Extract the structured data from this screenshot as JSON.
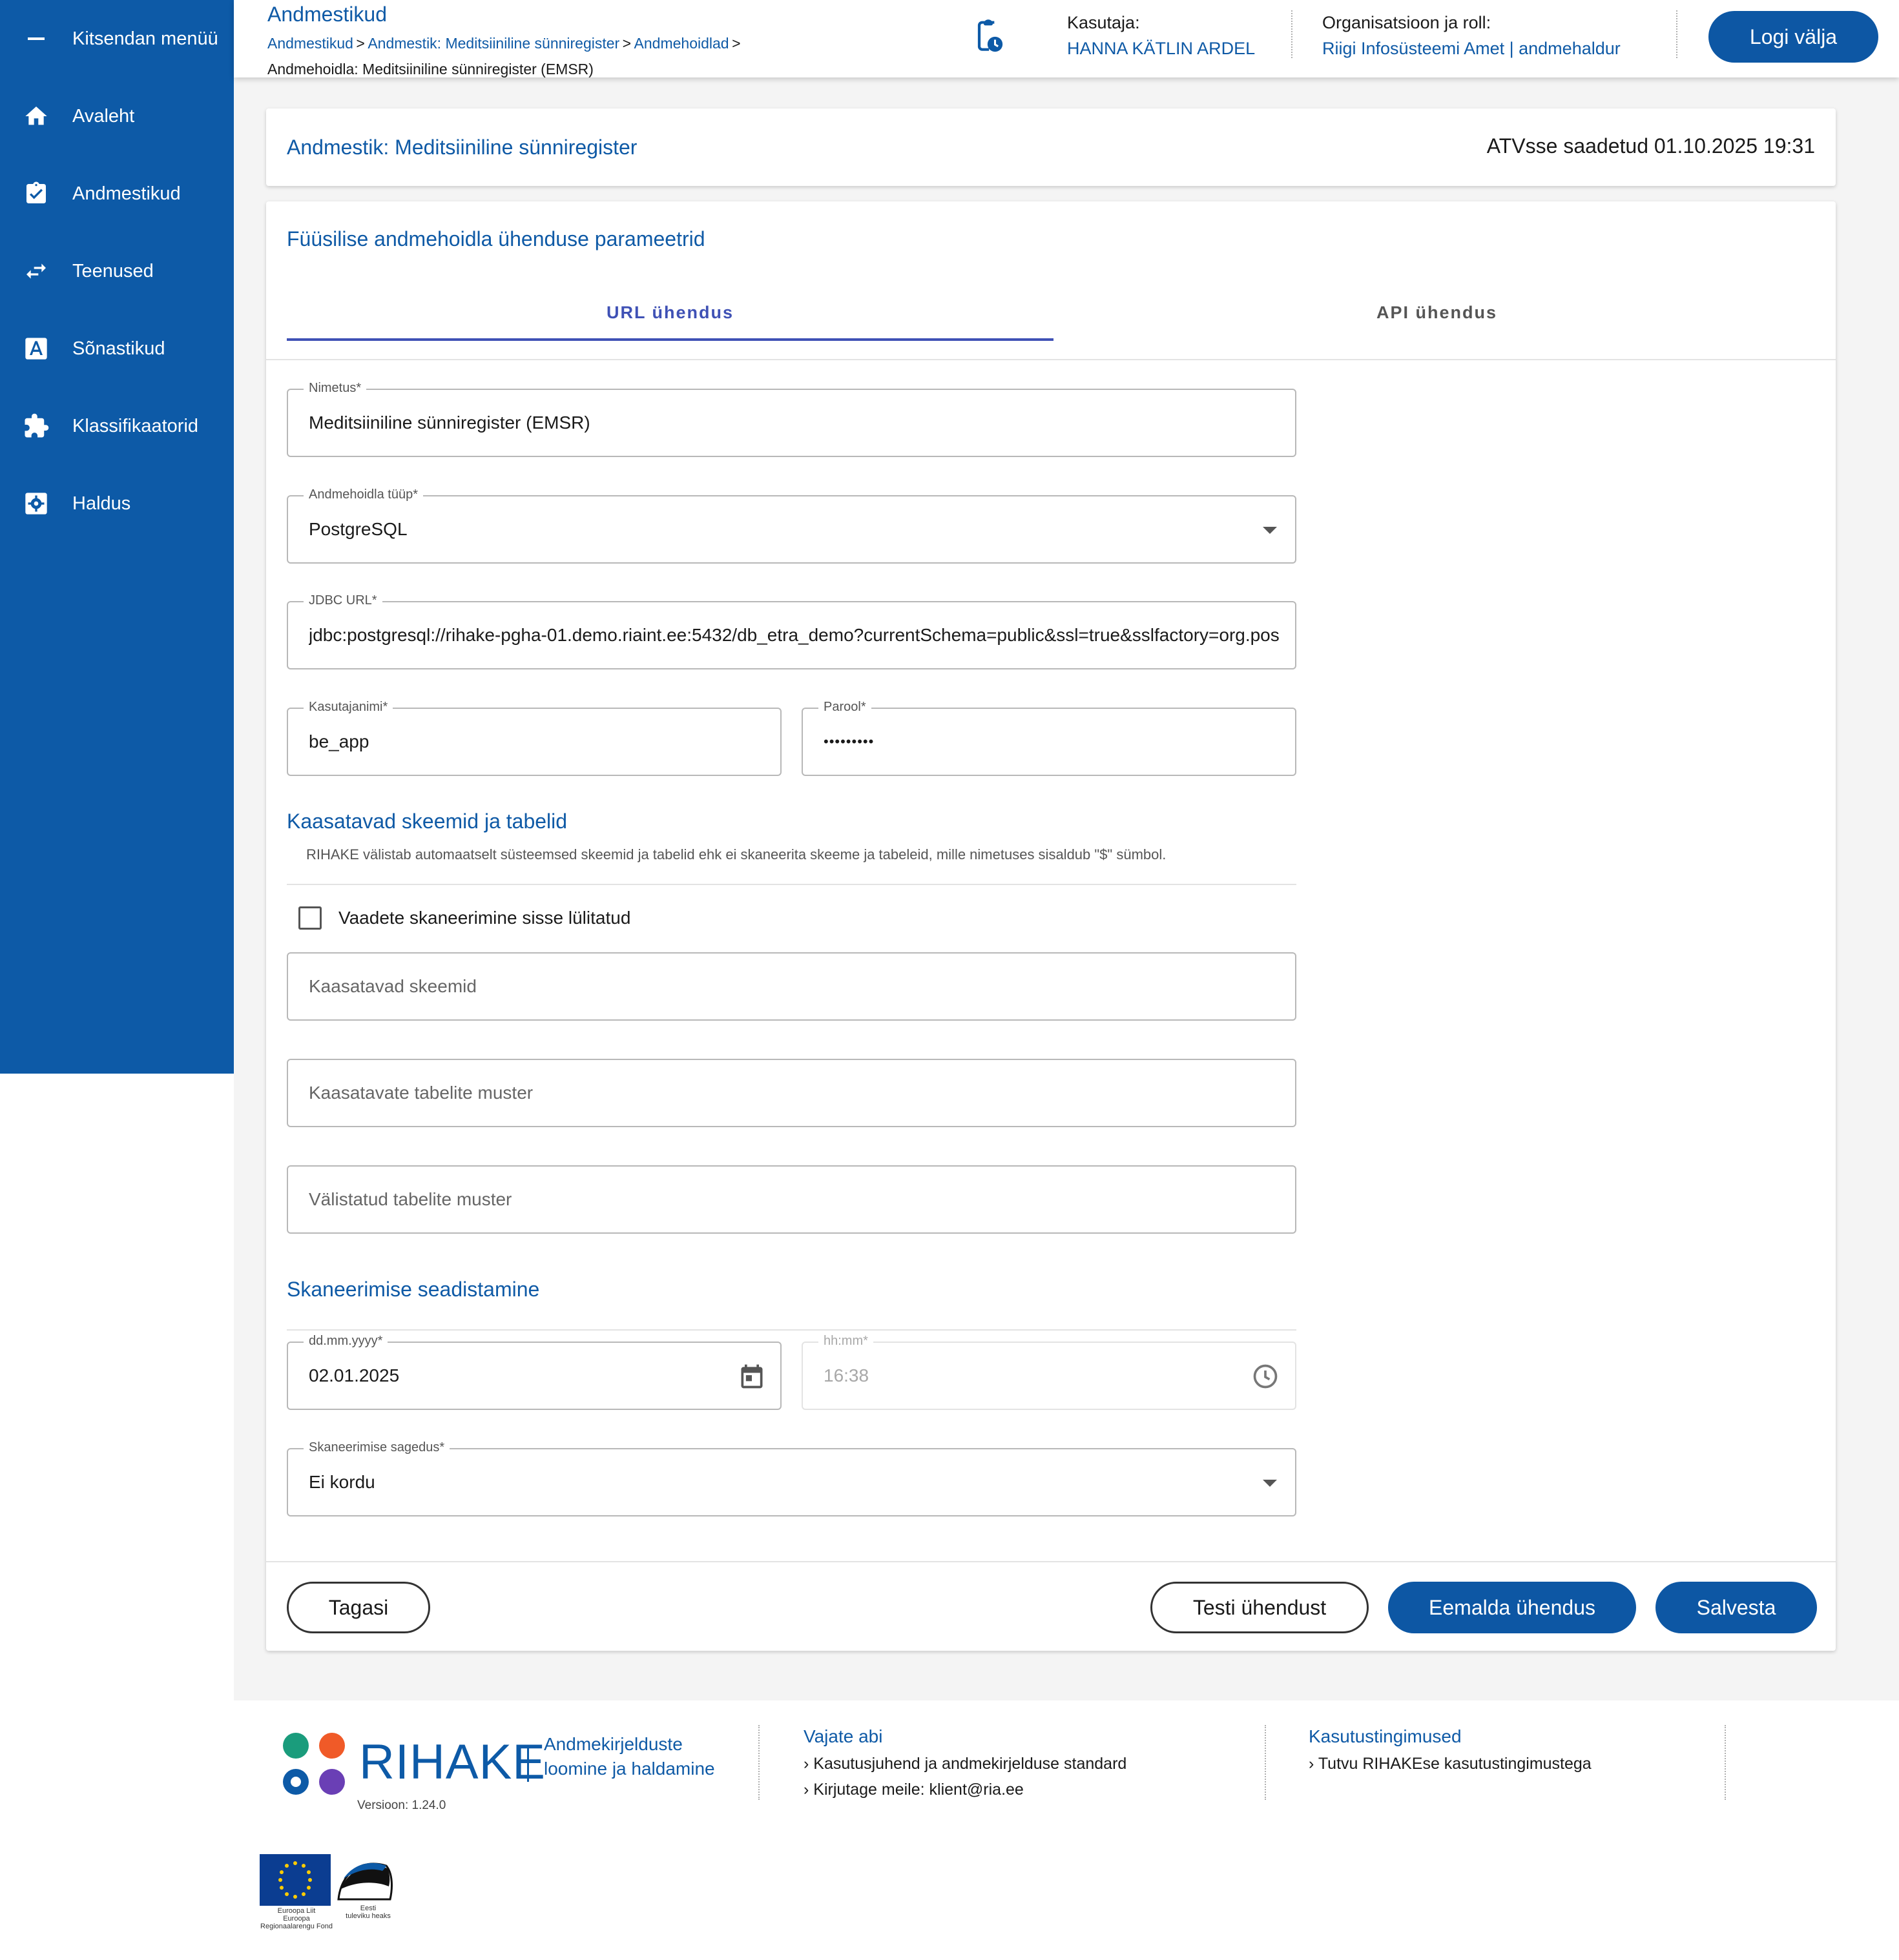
{
  "sidebar": {
    "collapse_label": "Kitsendan menüü",
    "items": [
      {
        "label": "Avaleht",
        "icon": "home-icon"
      },
      {
        "label": "Andmestikud",
        "icon": "clipboard-check-icon"
      },
      {
        "label": "Teenused",
        "icon": "swap-arrows-icon"
      },
      {
        "label": "Sõnastikud",
        "icon": "dictionary-a-icon"
      },
      {
        "label": "Klassifikaatorid",
        "icon": "puzzle-icon"
      },
      {
        "label": "Haldus",
        "icon": "admin-settings-icon"
      }
    ]
  },
  "header": {
    "title": "Andmestikud",
    "breadcrumb": {
      "items": [
        "Andmestikud",
        "Andmestik: Meditsiiniline sünniregister",
        "Andmehoidlad"
      ],
      "separator": ">",
      "current": "Andmehoidla: Meditsiiniline sünniregister (EMSR)"
    },
    "user_label": "Kasutaja:",
    "user_name": "HANNA KÄTLIN ARDEL",
    "org_label": "Organisatsioon ja roll:",
    "org_value": "Riigi Infosüsteemi Amet | andmehaldur",
    "logout_label": "Logi välja"
  },
  "dataset_card": {
    "title": "Andmestik: Meditsiiniline sünniregister",
    "status": "ATVsse saadetud 01.10.2025 19:31"
  },
  "form": {
    "title": "Füüsilise andmehoidla ühenduse parameetrid",
    "tabs": [
      {
        "label": "URL ühendus",
        "active": true
      },
      {
        "label": "API ühendus",
        "active": false
      }
    ],
    "name": {
      "label": "Nimetus*",
      "value": "Meditsiiniline sünniregister (EMSR)"
    },
    "db_type": {
      "label": "Andmehoidla tüüp*",
      "value": "PostgreSQL"
    },
    "jdbc": {
      "label": "JDBC URL*",
      "value": "jdbc:postgresql://rihake-pgha-01.demo.riaint.ee:5432/db_etra_demo?currentSchema=public&ssl=true&sslfactory=org.pos"
    },
    "username": {
      "label": "Kasutajanimi*",
      "value": "be_app"
    },
    "password": {
      "label": "Parool*",
      "value": "•••••••••"
    },
    "schemas_section": {
      "title": "Kaasatavad skeemid ja tabelid",
      "hint": "RIHAKE välistab automaatselt süsteemsed skeemid ja tabelid ehk ei skaneerita skeeme ja tabeleid, mille nimetuses sisaldub \"$\" sümbol."
    },
    "views_checkbox": {
      "label": "Vaadete skaneerimine sisse lülitatud",
      "checked": false
    },
    "include_schemas": {
      "placeholder": "Kaasatavad skeemid"
    },
    "include_tables": {
      "placeholder": "Kaasatavate tabelite muster"
    },
    "exclude_tables": {
      "placeholder": "Välistatud tabelite muster"
    },
    "scan_section": {
      "title": "Skaneerimise seadistamine"
    },
    "date": {
      "label": "dd.mm.yyyy*",
      "value": "02.01.2025"
    },
    "time": {
      "label": "hh:mm*",
      "value": "16:38"
    },
    "frequency": {
      "label": "Skaneerimise sagedus*",
      "value": "Ei kordu"
    },
    "buttons": {
      "back": "Tagasi",
      "test": "Testi ühendust",
      "remove": "Eemalda ühendus",
      "save": "Salvesta"
    }
  },
  "footer": {
    "brand": "RIHAKE",
    "tagline_1": "Andmekirjelduste",
    "tagline_2": "loomine ja haldamine",
    "version": "Versioon: 1.24.0",
    "help_title": "Vajate abi",
    "help_link_1": "Kasutusjuhend ja andmekirjelduse standard",
    "help_mail_label": "Kirjutage meile:",
    "help_mail": "klient@ria.ee",
    "terms_title": "Kasutustingimused",
    "terms_link": "Tutvu RIHAKEse kasutustingimustega",
    "eu_logo_text": [
      "Euroopa Liit",
      "Euroopa",
      "Regionaalarengu Fond"
    ],
    "ee_logo_text": [
      "Eesti",
      "tuleviku heaks"
    ]
  },
  "colors": {
    "primary": "#0d5aa7",
    "link": "#0f5aa6",
    "logo_dots": [
      "#1a9c7c",
      "#f05a28",
      "#0d5aa7",
      "#6a3fb5"
    ]
  }
}
